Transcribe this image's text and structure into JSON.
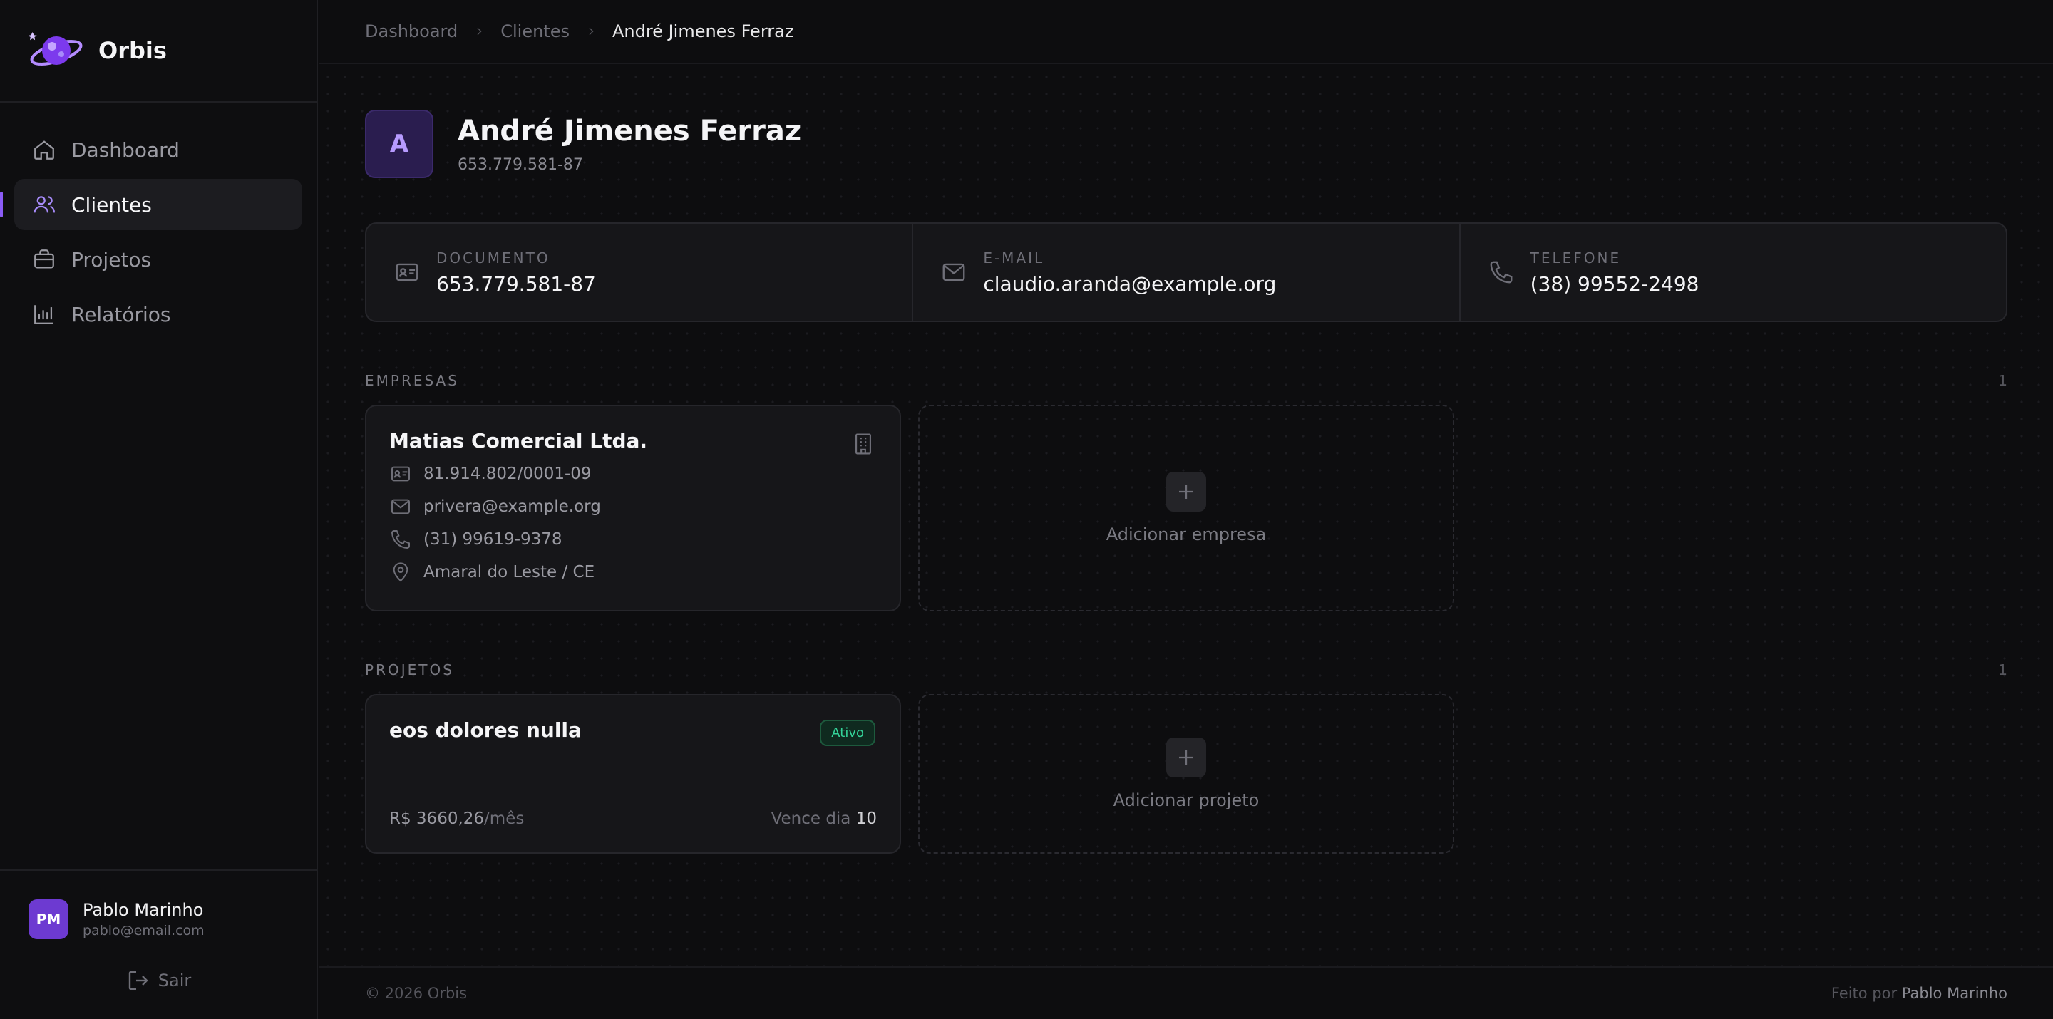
{
  "app": {
    "name": "Orbis"
  },
  "sidebar": {
    "items": [
      {
        "label": "Dashboard",
        "icon": "home-icon",
        "active": false
      },
      {
        "label": "Clientes",
        "icon": "users-icon",
        "active": true
      },
      {
        "label": "Projetos",
        "icon": "briefcase-icon",
        "active": false
      },
      {
        "label": "Relatórios",
        "icon": "bar-chart-icon",
        "active": false
      }
    ],
    "user": {
      "initials": "PM",
      "name": "Pablo Marinho",
      "email": "pablo@email.com"
    },
    "logout_label": "Sair"
  },
  "breadcrumb": {
    "items": [
      "Dashboard",
      "Clientes"
    ],
    "current": "André Jimenes Ferraz"
  },
  "client": {
    "initial": "A",
    "name": "André Jimenes Ferraz",
    "document": "653.779.581-87"
  },
  "info": {
    "document_label": "DOCUMENTO",
    "document_value": "653.779.581-87",
    "email_label": "E-MAIL",
    "email_value": "claudio.aranda@example.org",
    "phone_label": "TELEFONE",
    "phone_value": "(38) 99552-2498"
  },
  "companies": {
    "title": "EMPRESAS",
    "count": "1",
    "items": [
      {
        "name": "Matias Comercial Ltda.",
        "cnpj": "81.914.802/0001-09",
        "email": "privera@example.org",
        "phone": "(31) 99619-9378",
        "location": "Amaral do Leste / CE"
      }
    ],
    "add_label": "Adicionar empresa"
  },
  "projects": {
    "title": "PROJETOS",
    "count": "1",
    "items": [
      {
        "name": "eos dolores nulla",
        "status": "Ativo",
        "status_color": "#34d399",
        "price": "R$ 3660,26",
        "price_unit": "/mês",
        "due_label": "Vence dia",
        "due_day": "10"
      }
    ],
    "add_label": "Adicionar projeto"
  },
  "footer": {
    "copyright": "© 2026 Orbis",
    "made_by_label": "Feito por",
    "author": "Pablo Marinho"
  },
  "colors": {
    "accent": "#8b5cf6",
    "avatar_bg": "#6d3ad1",
    "success": "#34d399"
  }
}
